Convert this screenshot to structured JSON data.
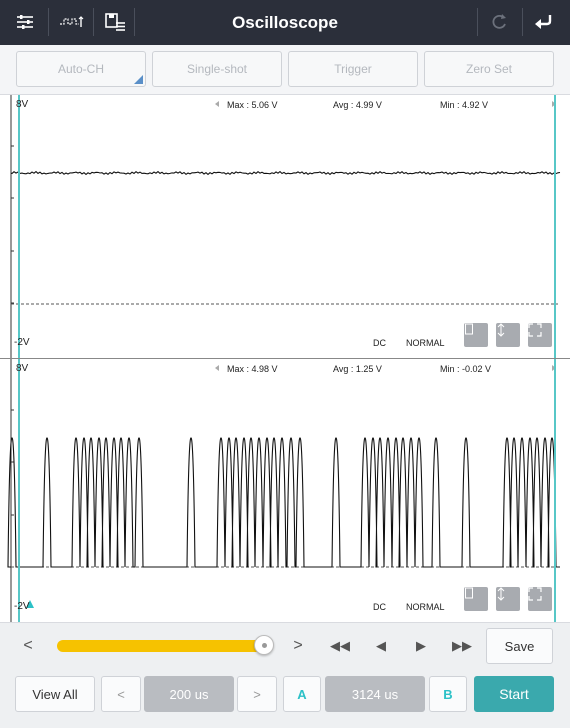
{
  "titlebar": {
    "title": "Oscilloscope",
    "icons": [
      "settings-sliders-icon",
      "waveform-icon",
      "save-list-icon",
      "refresh-icon",
      "back-icon"
    ]
  },
  "mode_buttons": {
    "auto_ch": "Auto-CH",
    "single_shot": "Single-shot",
    "trigger": "Trigger",
    "zero_set": "Zero Set"
  },
  "channel1": {
    "top_label": "8V",
    "bottom_label": "-2V",
    "max": "Max : 5.06 V",
    "avg": "Avg : 4.99 V",
    "min": "Min : 4.92 V",
    "coupling": "DC",
    "mode": "NORMAL"
  },
  "channel2": {
    "top_label": "8V",
    "bottom_label": "-2V",
    "max": "Max : 4.98 V",
    "avg": "Avg : 1.25 V",
    "min": "Min : -0.02 V",
    "coupling": "DC",
    "mode": "NORMAL"
  },
  "scroll": {
    "prev": "<",
    "next": ">",
    "fast_back": "◀◀",
    "step_back": "◀",
    "step_fwd": "▶",
    "fast_fwd": "▶▶",
    "save": "Save"
  },
  "bottom": {
    "view_all": "View All",
    "dec": "<",
    "timebase": "200 us",
    "inc": ">",
    "cursor_a": "A",
    "cursor_delta": "3124 us",
    "cursor_b": "B",
    "start": "Start"
  },
  "colors": {
    "titlebar": "#2b2f3a",
    "cursor": "#57c7c7",
    "slider": "#f6c200",
    "start_button": "#3aa9ad"
  }
}
